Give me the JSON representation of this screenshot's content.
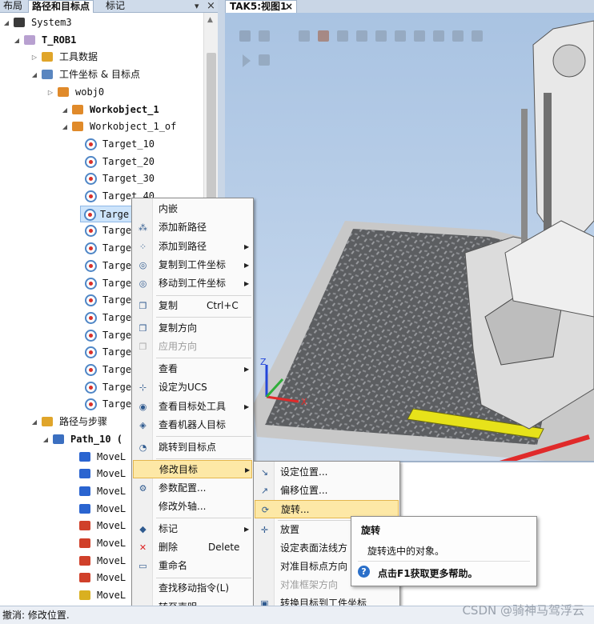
{
  "left_tabs": {
    "layout": "布局",
    "paths": "路径和目标点",
    "tags": "标记",
    "pin": "▾",
    "close": "×"
  },
  "tree": [
    {
      "label": "System3",
      "exp": "◢",
      "icon": "station-icon"
    },
    {
      "label": "T_ROB1",
      "exp": "◢",
      "icon": "robot-task-icon",
      "bold": true
    },
    {
      "label": "工具数据",
      "exp": "▷",
      "icon": "tooldata-folder-icon",
      "cn": true
    },
    {
      "label": "工件坐标 & 目标点",
      "exp": "◢",
      "icon": "workobject-folder-icon",
      "cn": true
    },
    {
      "label": "wobj0",
      "exp": "▷",
      "icon": "frame-icon"
    },
    {
      "label": "Workobject_1",
      "exp": "◢",
      "icon": "frame-icon",
      "bold": true
    },
    {
      "label": "Workobject_1_of",
      "exp": "◢",
      "icon": "frame-icon"
    },
    {
      "label": "Target_10",
      "icon": "target-icon"
    },
    {
      "label": "Target_20",
      "icon": "target-icon"
    },
    {
      "label": "Target_30",
      "icon": "target-icon"
    },
    {
      "label": "Target_40",
      "icon": "target-icon"
    },
    {
      "label": "Targe",
      "icon": "target-icon",
      "selected": true
    },
    {
      "label": "Targe",
      "icon": "target-icon"
    },
    {
      "label": "Targe",
      "icon": "target-icon"
    },
    {
      "label": "Targe",
      "icon": "target-icon"
    },
    {
      "label": "Targe",
      "icon": "target-icon"
    },
    {
      "label": "Targe",
      "icon": "target-icon"
    },
    {
      "label": "Targe",
      "icon": "target-icon"
    },
    {
      "label": "Targe",
      "icon": "target-icon"
    },
    {
      "label": "Targe",
      "icon": "target-icon"
    },
    {
      "label": "Targe",
      "icon": "target-icon"
    },
    {
      "label": "Targe",
      "icon": "target-icon"
    },
    {
      "label": "Targe",
      "icon": "target-icon"
    },
    {
      "label": "路径与步骤",
      "exp": "◢",
      "icon": "paths-folder-icon",
      "cn": true
    },
    {
      "label": "Path_10 (",
      "exp": "◢",
      "icon": "path-icon",
      "bold": true
    },
    {
      "label": "MoveL Ta",
      "icon": "movel-icon"
    },
    {
      "label": "MoveL Ta",
      "icon": "movel-icon"
    },
    {
      "label": "MoveL Ta",
      "icon": "movel-icon"
    },
    {
      "label": "MoveL Ta",
      "icon": "movel-icon"
    },
    {
      "label": "MoveL Ta",
      "icon": "movel-warn-icon"
    },
    {
      "label": "MoveL Ta",
      "icon": "movel-warn-icon"
    },
    {
      "label": "MoveL Ta",
      "icon": "movel-warn-icon"
    },
    {
      "label": "MoveL Ta",
      "icon": "movel-warn-icon"
    },
    {
      "label": "MoveL Ta",
      "icon": "movel-alert-icon"
    }
  ],
  "view_tab": {
    "title": "TAK5:视图1",
    "close": "×"
  },
  "main_menu": [
    {
      "label": "内嵌",
      "icon": ""
    },
    {
      "label": "添加新路径",
      "icon": "new-path-icon"
    },
    {
      "label": "添加到路径",
      "icon": "add-to-path-icon",
      "submenu": true
    },
    {
      "label": "复制到工件坐标",
      "icon": "copy-to-wobj-icon",
      "submenu": true
    },
    {
      "label": "移动到工件坐标",
      "icon": "move-to-wobj-icon",
      "submenu": true
    },
    {
      "sep": true
    },
    {
      "label": "复制",
      "shortcut": "Ctrl+C",
      "icon": "copy-icon"
    },
    {
      "sep": true
    },
    {
      "label": "复制方向",
      "icon": "copy-orientation-icon"
    },
    {
      "label": "应用方向",
      "icon": "apply-orientation-icon",
      "disabled": true
    },
    {
      "sep": true
    },
    {
      "label": "查看",
      "icon": "",
      "submenu": true
    },
    {
      "label": "设定为UCS",
      "icon": "set-ucs-icon"
    },
    {
      "label": "查看目标处工具",
      "icon": "view-tool-icon",
      "submenu": true
    },
    {
      "label": "查看机器人目标",
      "icon": "view-robtarget-icon"
    },
    {
      "sep": true
    },
    {
      "label": "跳转到目标点",
      "icon": "jump-to-target-icon"
    },
    {
      "sep": true
    },
    {
      "label": "修改目标",
      "icon": "",
      "submenu": true,
      "highlighted": true
    },
    {
      "label": "参数配置...",
      "icon": "configurations-icon"
    },
    {
      "label": "修改外轴...",
      "icon": ""
    },
    {
      "sep": true
    },
    {
      "label": "标记",
      "icon": "tag-icon",
      "submenu": true
    },
    {
      "label": "删除",
      "shortcut": "Delete",
      "icon": "delete-icon"
    },
    {
      "label": "重命名",
      "icon": "rename-icon"
    },
    {
      "sep": true
    },
    {
      "label": "查找移动指令(L)",
      "icon": ""
    },
    {
      "label": "转至声明",
      "icon": ""
    }
  ],
  "sub_menu": [
    {
      "label": "设定位置...",
      "icon": "set-position-icon"
    },
    {
      "label": "偏移位置...",
      "icon": "offset-position-icon"
    },
    {
      "label": "旋转...",
      "icon": "rotate-icon",
      "highlighted": true
    },
    {
      "sep": true
    },
    {
      "label": "放置",
      "icon": "place-icon"
    },
    {
      "label": "设定表面法线方",
      "icon": ""
    },
    {
      "label": "对准目标点方向",
      "icon": ""
    },
    {
      "label": "对准框架方向",
      "icon": "",
      "disabled": true
    },
    {
      "label": "转换目标到工件坐标",
      "icon": "convert-to-wobj-icon"
    }
  ],
  "tooltip": {
    "title": "旋转",
    "desc": "旋转选中的对象。",
    "help": "点击F1获取更多帮助。",
    "help_icon": "help-icon"
  },
  "statusbar": {
    "text": "撤消: 修改位置."
  },
  "watermark": "CSDN @骑神马驾浮云",
  "colors": {
    "highlight": "#fde8a6",
    "selection": "#cde4fb",
    "arrow": "#e02a2a",
    "target_ring": "#4f86c6"
  }
}
